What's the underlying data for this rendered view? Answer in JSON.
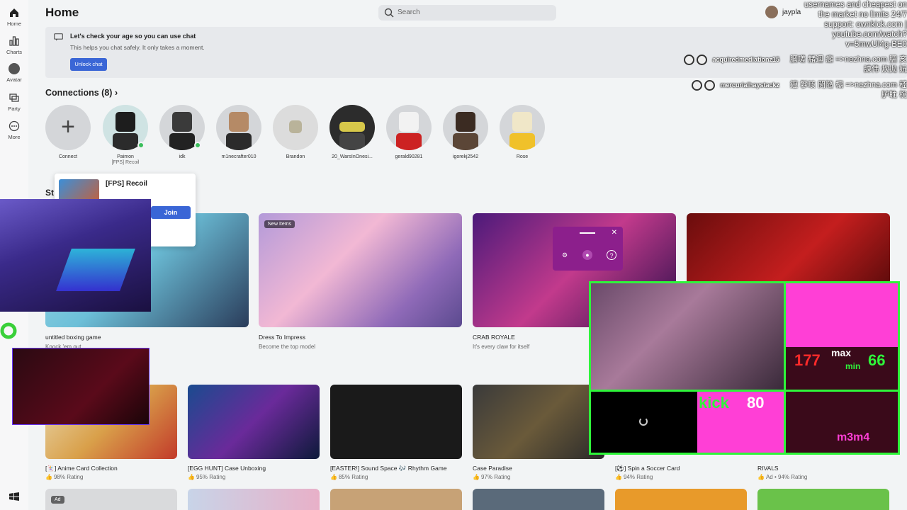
{
  "nav": {
    "items": [
      {
        "label": "Home",
        "icon": "home-icon"
      },
      {
        "label": "Charts",
        "icon": "charts-icon"
      },
      {
        "label": "Avatar",
        "icon": "avatar-icon"
      },
      {
        "label": "Party",
        "icon": "party-icon"
      },
      {
        "label": "More",
        "icon": "more-icon"
      }
    ]
  },
  "header": {
    "title": "Home",
    "search_placeholder": "Search",
    "username": "jaypla"
  },
  "banner": {
    "title": "Let's check your age so you can use chat",
    "subtitle": "This helps you chat safely. It only takes a moment.",
    "button": "Unlock chat"
  },
  "connections": {
    "title": "Connections (8)",
    "items": [
      {
        "name": "Connect",
        "sub": ""
      },
      {
        "name": "Paimon",
        "sub": "[FPS] Recoil"
      },
      {
        "name": "idk",
        "sub": ""
      },
      {
        "name": "m1necrafter010",
        "sub": ""
      },
      {
        "name": "Brandon",
        "sub": ""
      },
      {
        "name": "20_WarsInOnesi...",
        "sub": ""
      },
      {
        "name": "gerald90281",
        "sub": ""
      },
      {
        "name": "igorekj2542",
        "sub": ""
      },
      {
        "name": "Rose",
        "sub": ""
      }
    ]
  },
  "popover": {
    "game": "[FPS] Recoil",
    "join": "Join"
  },
  "section_heading_partial": "St",
  "row1": [
    {
      "title": "untitled boxing game",
      "sub": "Knock 'em out",
      "badge": ""
    },
    {
      "title": "Dress To Impress",
      "sub": "Become the top model",
      "badge": "New Items"
    },
    {
      "title": "CRAB ROYALE",
      "sub": "It's every claw for itself",
      "badge": ""
    },
    {
      "title": "",
      "sub": "",
      "badge": ""
    }
  ],
  "row2": [
    {
      "title": "[🃏] Anime Card Collection",
      "rating": "98% Rating"
    },
    {
      "title": "[EGG HUNT] Case Unboxing",
      "rating": "95% Rating"
    },
    {
      "title": "[EASTER!] Sound Space 🎶 Rhythm Game",
      "rating": "85% Rating"
    },
    {
      "title": "Case Paradise",
      "rating": "97% Rating"
    },
    {
      "title": "[⚽] Spin a Soccer Card",
      "rating": "94% Rating"
    },
    {
      "title": "RIVALS",
      "rating": "Ad • 94% Rating"
    }
  ],
  "row3_badge": "Ad",
  "overlay": {
    "chat_top": [
      "usernames and cheapest on",
      "the market no limits 24/7",
      "support: ownkick.com |",
      "youtube.com/watch?",
      "v=5mwUI4g-BE0"
    ],
    "chat_lines": [
      {
        "user": "acquiredmediationz15",
        "msg": "膕嗟 赭逥 癰 =>nezhna.com 臑 亥 諫伟 炊抛 妧"
      },
      {
        "user": "mercurialhaystackz",
        "msg": "鑹 鬖畡 閍隨 欛 =>nezhna.com 嵇 胪耽 梲"
      }
    ],
    "stats": {
      "max": "max",
      "min": "min",
      "val_left": "177",
      "val_right": "66",
      "kick": "kick",
      "kick_num": "80",
      "handle": "m3m4"
    }
  },
  "colors": {
    "accent": "#3a66d6",
    "online": "#3bbf5c",
    "overlay_green": "#2ef53a",
    "overlay_pink": "#ff3fd6"
  }
}
